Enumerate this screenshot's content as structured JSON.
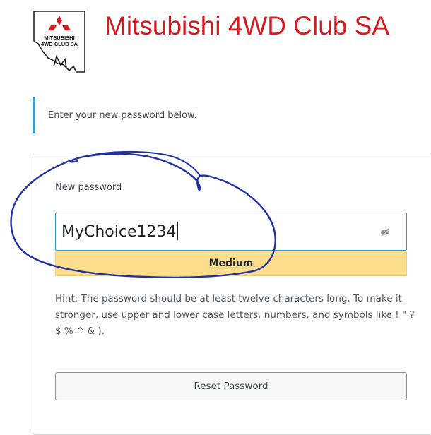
{
  "header": {
    "logo_line1": "MITSUBISHI",
    "logo_line2": "4WD CLUB SA",
    "site_title": "Mitsubishi 4WD Club SA"
  },
  "message": "Enter your new password below.",
  "form": {
    "label": "New password",
    "password_value": "MyChoice1234",
    "strength": "Medium",
    "hint": "Hint: The password should be at least twelve characters long. To make it stronger, use upper and lower case letters, numbers, and symbols like ! \" ? $ % ^ & ).",
    "submit_label": "Reset Password"
  },
  "colors": {
    "brand_red": "#d71920",
    "accent_blue": "#2c9ec9",
    "strength_medium": "#fcdd8c",
    "annotation_ink": "#1f2fa8"
  },
  "icons": {
    "visibility_toggle": "eye-slash-icon",
    "logo": "mitsubishi-three-diamonds-logo"
  }
}
